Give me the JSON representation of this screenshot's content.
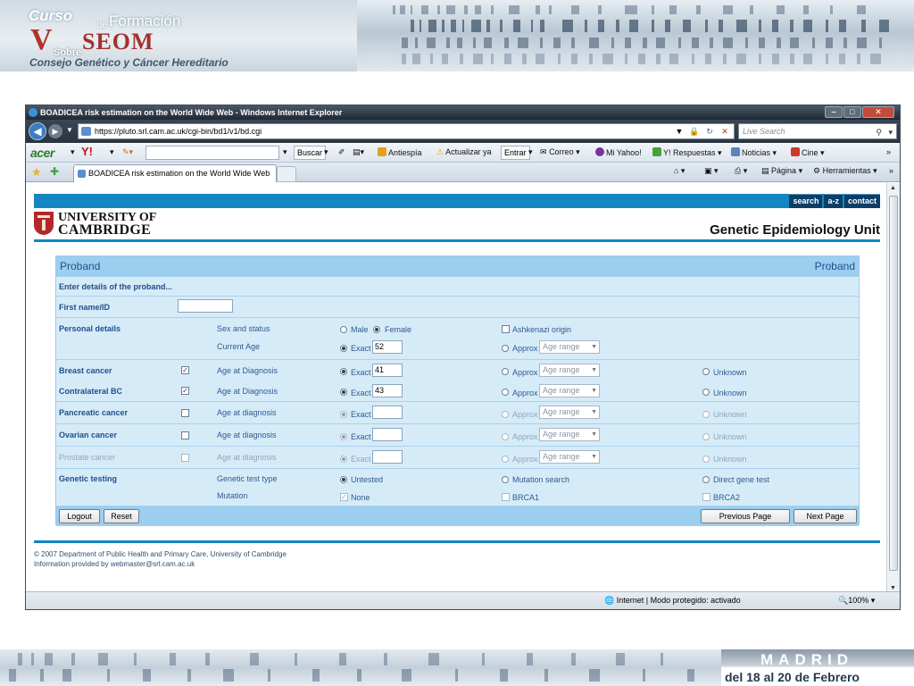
{
  "banner": {
    "curso": "Curso",
    "de": "de",
    "formacion": "Formación",
    "seom": "SEOM",
    "sobre": "Sobre",
    "subtitle": "Consejo Genético y Cáncer Hereditario",
    "madrid": "MADRID",
    "dates": "del 18 al 20 de Febrero"
  },
  "browser": {
    "window_title": "BOADICEA risk estimation on the World Wide Web - Windows Internet Explorer",
    "url": "https://pluto.srl.cam.ac.uk/cgi-bin/bd1/v1/bd.cgi",
    "search_placeholder": "Live Search",
    "toolbar": {
      "brand": "acer",
      "yahoo": "Y!",
      "buscar": "Buscar",
      "antiespia": "Antiespía",
      "actualizar": "Actualizar ya",
      "entrar": "Entrar",
      "correo": "Correo",
      "mi_yahoo": "Mi Yahoo!",
      "respuestas": "Y! Respuestas",
      "noticias": "Noticias",
      "cine": "Cine"
    },
    "tab_title": "BOADICEA risk estimation on the World Wide Web",
    "commands": {
      "pagina": "Página",
      "herramientas": "Herramientas"
    },
    "status": {
      "zone": "Internet | Modo protegido: activado",
      "zoom": "100%"
    }
  },
  "page": {
    "top_links": [
      "search",
      "a-z",
      "contact"
    ],
    "university_line1": "UNIVERSITY OF",
    "university_line2": "CAMBRIDGE",
    "unit": "Genetic Epidemiology Unit",
    "form": {
      "title_left": "Proband",
      "title_right": "Proband",
      "instructions": "Enter details of the proband...",
      "first_name_label": "First name/ID",
      "first_name_value": "",
      "personal_details": "Personal details",
      "sex_and_status": "Sex and status",
      "male": "Male",
      "female": "Female",
      "ashkenazi": "Ashkenazi origin",
      "current_age": "Current Age",
      "exact": "Exact",
      "approx": "Approx",
      "age_range": "Age range",
      "unknown": "Unknown",
      "current_age_value": "52",
      "breast_cancer": "Breast cancer",
      "contralateral_bc": "Contralateral BC",
      "pancreatic_cancer": "Pancreatic cancer",
      "ovarian_cancer": "Ovarian cancer",
      "prostate_cancer": "Prostate cancer",
      "age_at_diagnosis_cap": "Age at Diagnosis",
      "age_at_diagnosis": "Age at diagnosis",
      "breast_age": "41",
      "contralateral_age": "43",
      "genetic_testing": "Genetic testing",
      "genetic_test_type": "Genetic test type",
      "untested": "Untested",
      "mutation_search": "Mutation search",
      "direct_gene_test": "Direct gene test",
      "mutation": "Mutation",
      "none": "None",
      "brca1": "BRCA1",
      "brca2": "BRCA2",
      "logout": "Logout",
      "reset": "Reset",
      "previous_page": "Previous Page",
      "next_page": "Next Page"
    },
    "footer_line1": "© 2007 Department of Public Health and Primary Care, University of Cambridge",
    "footer_line2": "Information provided by webmaster@srl.cam.ac.uk"
  }
}
